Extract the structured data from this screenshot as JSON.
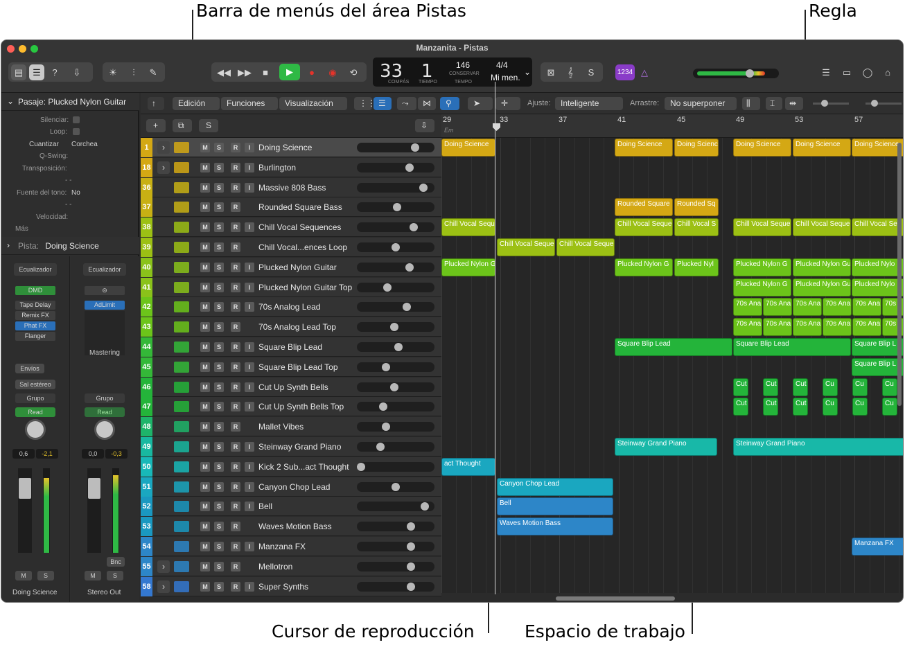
{
  "callouts": {
    "menubar": "Barra de menús del área Pistas",
    "ruler": "Regla",
    "playhead": "Cursor de reproducción",
    "workspace": "Espacio de trabajo"
  },
  "window": {
    "title": "Manzanita - Pistas"
  },
  "lcd": {
    "bar": "33",
    "beat": "1",
    "bar_label": "COMPÁS",
    "beat_label": "TIEMPO",
    "tempo": "146",
    "tempo_mode": "CONSERVAR",
    "tempo_label": "TEMPO",
    "signature": "4/4",
    "key": "Mi men."
  },
  "toolbar": {
    "count_in": "1234"
  },
  "inspector": {
    "region_header": "Pasaje:  Plucked Nylon Guitar",
    "mute_label": "Silenciar:",
    "loop_label": "Loop:",
    "quantize_label": "Cuantizar",
    "quantize_value": "Corchea",
    "qswing_label": "Q-Swing:",
    "transpose_label": "Transposición:",
    "pitch_source_label": "Fuente del tono:",
    "pitch_source_value": "No",
    "dash1": "- -",
    "dash2": "- -",
    "velocity_label": "Velocidad:",
    "more_label": "Más",
    "track_header_label": "Pista:",
    "track_header_value": "Doing Science",
    "strip1": {
      "eq": "Ecualizador",
      "plugins": [
        "DMD",
        "Tape Delay",
        "Remix FX",
        "Phat FX",
        "Flanger"
      ],
      "sends": "Envíos",
      "output": "Sal estéreo",
      "group": "Grupo",
      "automation": "Read",
      "vol": "0,6",
      "peak": "-2,1",
      "m": "M",
      "s": "S",
      "name": "Doing Science"
    },
    "strip2": {
      "eq": "Ecualizador",
      "plugins": [
        "AdLimit"
      ],
      "mastering": "Mastering",
      "group": "Grupo",
      "automation": "Read",
      "vol": "0,0",
      "peak": "-0,3",
      "bnc": "Bnc",
      "m": "M",
      "s": "S",
      "name": "Stereo Out"
    }
  },
  "trackbar": {
    "edit": "Edición",
    "functions": "Funciones",
    "view": "Visualización",
    "snap_label": "Ajuste:",
    "snap_value": "Inteligente",
    "drag_label": "Arrastre:",
    "drag_value": "No superponer",
    "add": "+",
    "s": "S"
  },
  "ruler": {
    "bars": [
      "29",
      "33",
      "37",
      "41",
      "45",
      "49",
      "53",
      "57"
    ],
    "chord": "Em"
  },
  "colors": {
    "yellow": "#d4a814",
    "olive": "#9cc014",
    "lime": "#6cc41a",
    "green": "#24b43a",
    "teal": "#18b8a8",
    "cyan": "#1aa7c0",
    "blue": "#2d86c8"
  },
  "tracks": [
    {
      "num": "1",
      "name": "Doing Science",
      "color": "#d4a814",
      "folder": true
    },
    {
      "num": "18",
      "name": "Burlington",
      "color": "#d4a814",
      "folder": true
    },
    {
      "num": "36",
      "name": "Massive 808 Bass",
      "color": "#c8b014"
    },
    {
      "num": "37",
      "name": "Rounded Square Bass",
      "color": "#c8b014"
    },
    {
      "num": "38",
      "name": "Chill Vocal Sequences",
      "color": "#9cc014"
    },
    {
      "num": "39",
      "name": "Chill Vocal...ences Loop",
      "color": "#9cc014"
    },
    {
      "num": "40",
      "name": "Plucked Nylon Guitar",
      "color": "#8ac21a"
    },
    {
      "num": "41",
      "name": "Plucked Nylon Guitar Top",
      "color": "#8ac21a"
    },
    {
      "num": "42",
      "name": "70s Analog Lead",
      "color": "#6cc41a"
    },
    {
      "num": "43",
      "name": "70s Analog Lead Top",
      "color": "#6cc41a"
    },
    {
      "num": "44",
      "name": "Square Blip Lead",
      "color": "#34b838"
    },
    {
      "num": "45",
      "name": "Square Blip Lead Top",
      "color": "#34b838"
    },
    {
      "num": "46",
      "name": "Cut Up Synth Bells",
      "color": "#24b43a"
    },
    {
      "num": "47",
      "name": "Cut Up Synth Bells Top",
      "color": "#24b43a"
    },
    {
      "num": "48",
      "name": "Mallet Vibes",
      "color": "#1eb46a"
    },
    {
      "num": "49",
      "name": "Steinway Grand Piano",
      "color": "#18b8a0"
    },
    {
      "num": "50",
      "name": "Kick 2 Sub...act Thought",
      "color": "#18b8b8"
    },
    {
      "num": "51",
      "name": "Canyon Chop Lead",
      "color": "#1aa7c0"
    },
    {
      "num": "52",
      "name": "Bell",
      "color": "#1a98c0"
    },
    {
      "num": "53",
      "name": "Waves Motion Bass",
      "color": "#1a98c0"
    },
    {
      "num": "54",
      "name": "Manzana FX",
      "color": "#2d86c8"
    },
    {
      "num": "55",
      "name": "Mellotron",
      "color": "#2d86c8",
      "folder": true
    },
    {
      "num": "58",
      "name": "Super Synths",
      "color": "#3478d0",
      "folder": true
    }
  ],
  "regions": {
    "doing_science": "Doing Science",
    "rounded_square": "Rounded Square",
    "rounded_sq": "Rounded Sq",
    "chill_vocal_seque": "Chill Vocal Seque",
    "chill_vocal_s": "Chill Vocal S",
    "chill_vocal_se": "Chill Vocal Se",
    "plucked_nylon_g": "Plucked Nylon G",
    "plucked_nyl": "Plucked Nyl",
    "plucked_nylon_gu": "Plucked Nylon Gu",
    "plucked_nylo": "Plucked Nylo",
    "analog": "70s Ana",
    "analog_short": "70s",
    "square_blip": "Square Blip Lead",
    "square_blip_l": "Square Blip L",
    "cut": "Cut",
    "cu": "Cu",
    "steinway": "Steinway Grand Piano",
    "thought": "act Thought",
    "canyon": "Canyon Chop Lead",
    "bell": "Bell",
    "waves": "Waves Motion Bass",
    "manzana": "Manzana FX"
  }
}
